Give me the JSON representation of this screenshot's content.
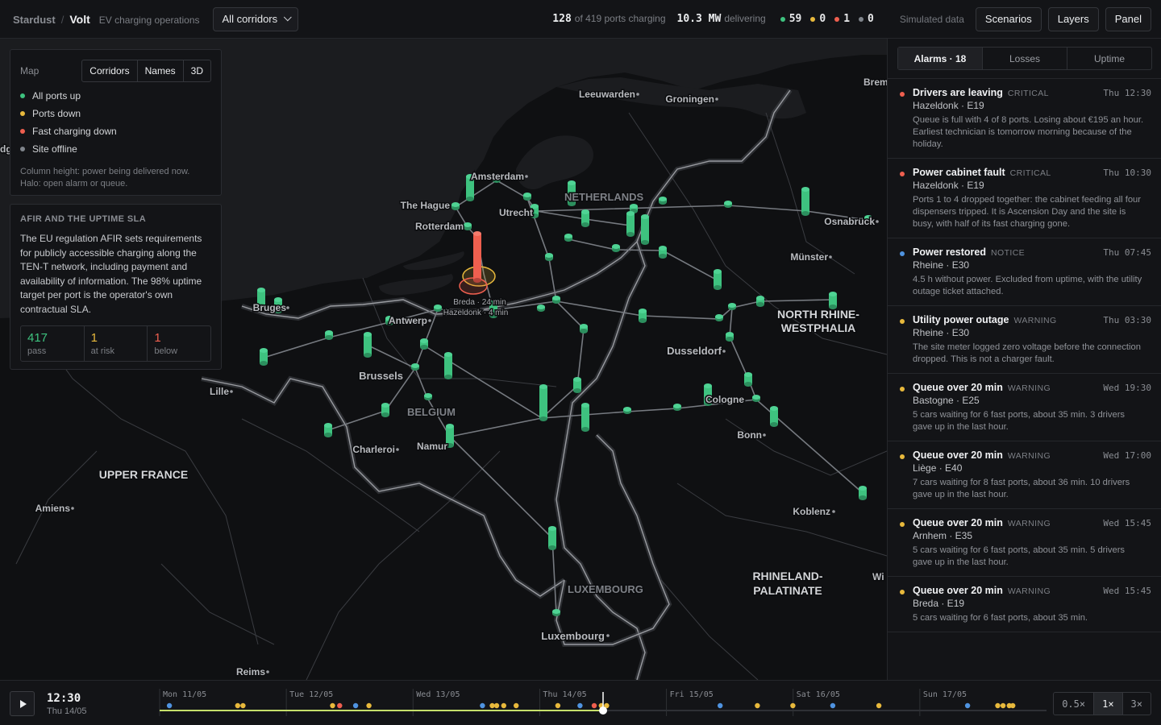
{
  "header": {
    "org": "Stardust",
    "separator": "/",
    "app": "Volt",
    "subtitle": "EV charging operations",
    "corridor_select": "All corridors",
    "ports_charging": "128",
    "ports_total_label": "of 419 ports charging",
    "power": "10.3 MW",
    "power_label": "delivering",
    "counts": [
      {
        "name": "all-up",
        "value": "59",
        "color": "#3ec27f"
      },
      {
        "name": "ports-down",
        "value": "0",
        "color": "#e8b93c"
      },
      {
        "name": "fast-down",
        "value": "1",
        "color": "#ef5f4f"
      },
      {
        "name": "offline",
        "value": "0",
        "color": "#7f848b"
      }
    ],
    "simulated": "Simulated data",
    "buttons": {
      "scenarios": "Scenarios",
      "layers": "Layers",
      "panel": "Panel"
    }
  },
  "legend": {
    "title": "Map",
    "toggles": [
      "Corridors",
      "Names",
      "3D"
    ],
    "items": [
      {
        "label": "All ports up",
        "color": "#3ec27f"
      },
      {
        "label": "Ports down",
        "color": "#e8b93c"
      },
      {
        "label": "Fast charging down",
        "color": "#ef5f4f"
      },
      {
        "label": "Site offline",
        "color": "#7f848b"
      }
    ],
    "note_1": "Column height: power being delivered now.",
    "note_2": "Halo: open alarm or queue."
  },
  "sla": {
    "title": "AFIR AND THE UPTIME SLA",
    "text": "The EU regulation AFIR sets requirements for publicly accessible charging along the TEN-T network, including payment and availability of information. The 98% uptime target per port is the operator's own contractual SLA.",
    "boxes": [
      {
        "value": "417",
        "label": "pass",
        "color": "#3ec27f"
      },
      {
        "value": "1",
        "label": "at risk",
        "color": "#e8b93c"
      },
      {
        "value": "1",
        "label": "below",
        "color": "#ef5f4f"
      }
    ]
  },
  "map": {
    "labels": {
      "country_nl": "NETHERLANDS",
      "country_be": "BELGIUM",
      "country_lu": "LUXEMBOURG",
      "region_nrw_1": "NORTH RHINE-",
      "region_nrw_2": "WESTPHALIA",
      "region_rp_1": "RHINELAND-",
      "region_rp_2": "PALATINATE",
      "region_fr": "UPPER FRANCE"
    },
    "cities": {
      "leeuwarden": "Leeuwarden",
      "groningen": "Groningen",
      "bremen": "Brem",
      "amsterdam": "Amsterdam",
      "thehague": "The Hague",
      "utrecht": "Utrecht",
      "rotterdam": "Rotterdam",
      "osnabrueck": "Osnabrück",
      "muenster": "Münster",
      "antwerp": "Antwerp",
      "bruges": "Bruges",
      "brussels": "Brussels",
      "dusseldorf": "Dusseldorf",
      "lille": "Lille",
      "cologne": "Cologne",
      "bonn": "Bonn",
      "charleroi": "Charleroi",
      "namur": "Namur",
      "amiens": "Amiens",
      "koblenz": "Koblenz",
      "wiesbaden": "Wi",
      "luxembourg": "Luxembourg",
      "reims": "Reims",
      "bg": "dg"
    },
    "site_labels": {
      "breda": "Breda · 24 min",
      "hazeldonk": "Hazeldonk · 4 min"
    }
  },
  "sidebar": {
    "tabs": [
      "Alarms · 18",
      "Losses",
      "Uptime"
    ],
    "alarms": [
      {
        "title": "Drivers are leaving",
        "severity": "CRITICAL",
        "color": "#ef5f4f",
        "time": "Thu 12:30",
        "site": "Hazeldonk · E19",
        "desc": "Queue is full with 4 of 8 ports. Losing about €195 an hour. Earliest technician is tomorrow morning because of the holiday."
      },
      {
        "title": "Power cabinet fault",
        "severity": "CRITICAL",
        "color": "#ef5f4f",
        "time": "Thu 10:30",
        "site": "Hazeldonk · E19",
        "desc": "Ports 1 to 4 dropped together: the cabinet feeding all four dispensers tripped. It is Ascension Day and the site is busy, with half of its fast charging gone."
      },
      {
        "title": "Power restored",
        "severity": "NOTICE",
        "color": "#4f93e0",
        "time": "Thu 07:45",
        "site": "Rheine · E30",
        "desc": "4.5 h without power. Excluded from uptime, with the utility outage ticket attached."
      },
      {
        "title": "Utility power outage",
        "severity": "WARNING",
        "color": "#e8b93c",
        "time": "Thu 03:30",
        "site": "Rheine · E30",
        "desc": "The site meter logged zero voltage before the connection dropped. This is not a charger fault."
      },
      {
        "title": "Queue over 20 min",
        "severity": "WARNING",
        "color": "#e8b93c",
        "time": "Wed 19:30",
        "site": "Bastogne · E25",
        "desc": "5 cars waiting for 6 fast ports, about 35 min. 3 drivers gave up in the last hour."
      },
      {
        "title": "Queue over 20 min",
        "severity": "WARNING",
        "color": "#e8b93c",
        "time": "Wed 17:00",
        "site": "Liège · E40",
        "desc": "7 cars waiting for 8 fast ports, about 36 min. 10 drivers gave up in the last hour."
      },
      {
        "title": "Queue over 20 min",
        "severity": "WARNING",
        "color": "#e8b93c",
        "time": "Wed 15:45",
        "site": "Arnhem · E35",
        "desc": "5 cars waiting for 6 fast ports, about 35 min. 5 drivers gave up in the last hour."
      },
      {
        "title": "Queue over 20 min",
        "severity": "WARNING",
        "color": "#e8b93c",
        "time": "Wed 15:45",
        "site": "Breda · E19",
        "desc": "5 cars waiting for 6 fast ports, about 35 min."
      }
    ]
  },
  "timeline": {
    "time": "12:30",
    "date": "Thu 14/05",
    "days": [
      "Mon 11/05",
      "Tue 12/05",
      "Wed 13/05",
      "Thu 14/05",
      "Fri 15/05",
      "Sat 16/05",
      "Sun 17/05"
    ],
    "speeds": [
      "0.5×",
      "1×",
      "3×"
    ],
    "active_speed": "1×",
    "progress": 0.5
  }
}
